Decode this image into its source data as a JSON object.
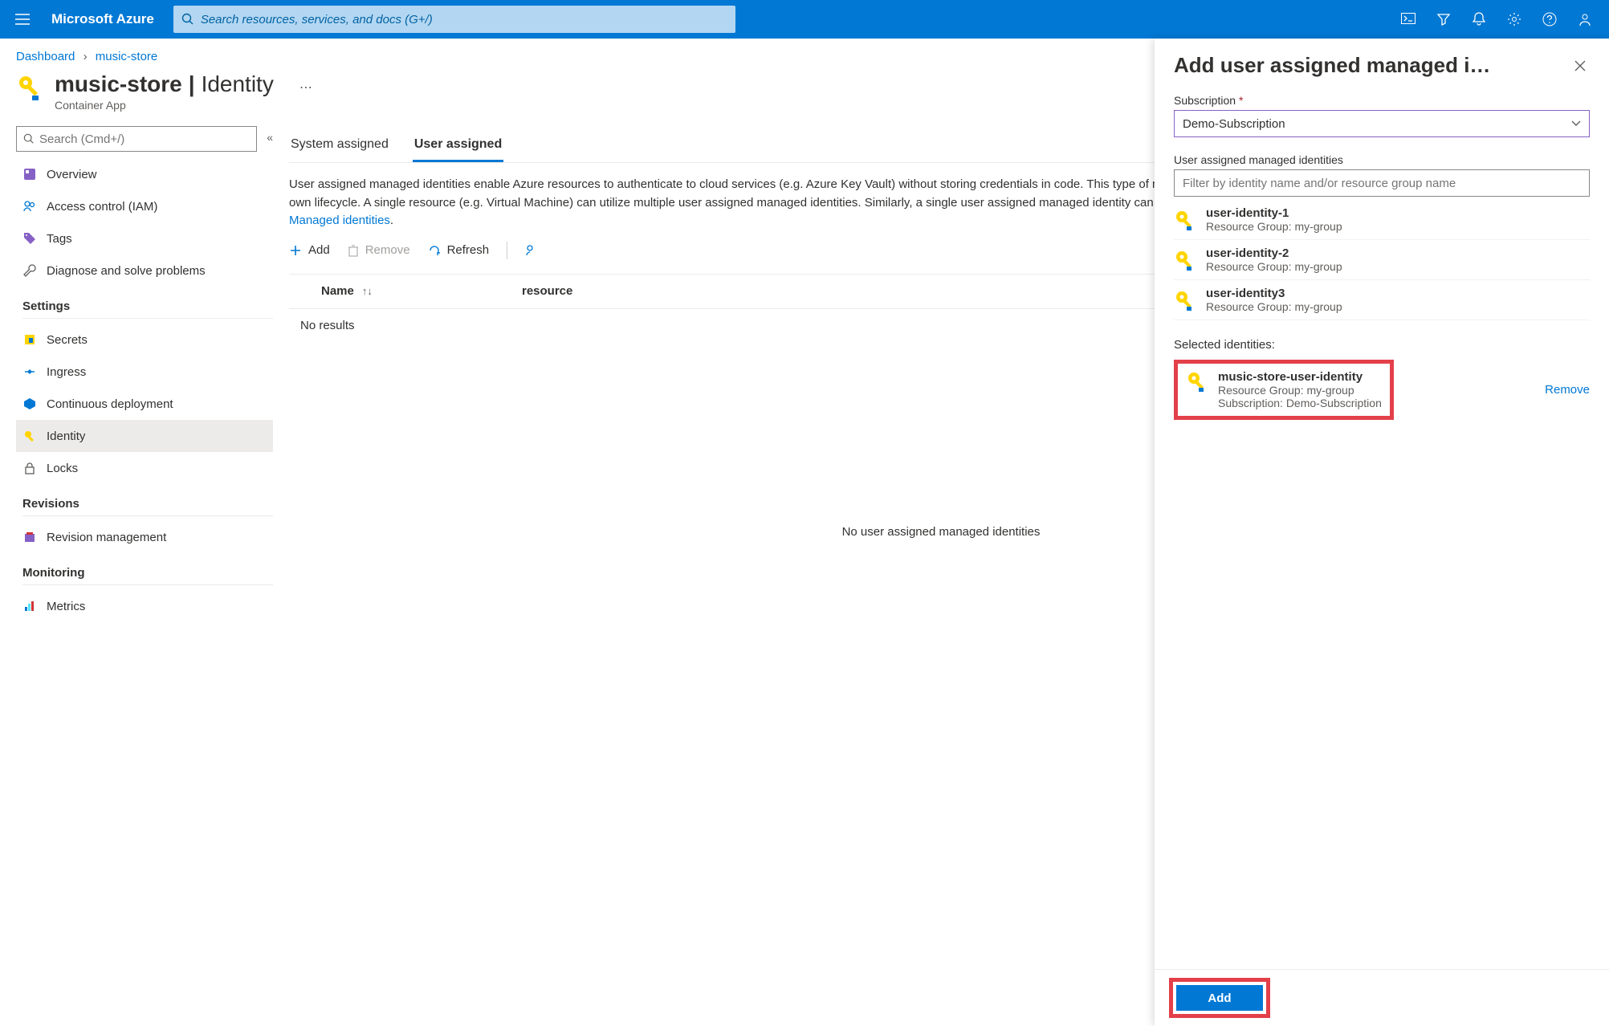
{
  "header": {
    "brand": "Microsoft Azure",
    "search_placeholder": "Search resources, services, and docs (G+/)"
  },
  "breadcrumb": {
    "items": [
      "Dashboard",
      "music-store"
    ]
  },
  "resource": {
    "name": "music-store",
    "section": "Identity",
    "type": "Container App"
  },
  "sidebar": {
    "search_placeholder": "Search (Cmd+/)",
    "top_items": [
      {
        "label": "Overview"
      },
      {
        "label": "Access control (IAM)"
      },
      {
        "label": "Tags"
      },
      {
        "label": "Diagnose and solve problems"
      }
    ],
    "sections": [
      {
        "title": "Settings",
        "items": [
          {
            "label": "Secrets"
          },
          {
            "label": "Ingress"
          },
          {
            "label": "Continuous deployment"
          },
          {
            "label": "Identity",
            "active": true
          },
          {
            "label": "Locks"
          }
        ]
      },
      {
        "title": "Revisions",
        "items": [
          {
            "label": "Revision management"
          }
        ]
      },
      {
        "title": "Monitoring",
        "items": [
          {
            "label": "Metrics"
          }
        ]
      }
    ]
  },
  "tabs": [
    {
      "label": "System assigned",
      "active": false
    },
    {
      "label": "User assigned",
      "active": true
    }
  ],
  "description": {
    "text": "User assigned managed identities enable Azure resources to authenticate to cloud services (e.g. Azure Key Vault) without storing credentials in code. This type of managed identities are created as standalone Azure resources, and have their own lifecycle. A single resource (e.g. Virtual Machine) can utilize multiple user assigned managed identities. Similarly, a single user assigned managed identity can be shared across multiple resources (e.g. Virtual Machines). Learn more about",
    "link": "Managed identities"
  },
  "toolbar": {
    "add": "Add",
    "remove": "Remove",
    "refresh": "Refresh"
  },
  "table": {
    "col_name": "Name",
    "col_rest": "resource",
    "no_results": "No results",
    "empty": "No user assigned managed identities"
  },
  "flyout": {
    "title": "Add user assigned managed i…",
    "sub_label": "Subscription",
    "sub_value": "Demo-Subscription",
    "list_label": "User assigned managed identities",
    "filter_placeholder": "Filter by identity name and/or resource group name",
    "items": [
      {
        "name": "user-identity-1",
        "rg": "Resource Group: my-group"
      },
      {
        "name": "user-identity-2",
        "rg": "Resource Group: my-group"
      },
      {
        "name": "user-identity3",
        "rg": "Resource Group: my-group"
      }
    ],
    "selected_label": "Selected identities:",
    "selected": {
      "name": "music-store-user-identity",
      "rg": "Resource Group: my-group",
      "sub": "Subscription: Demo-Subscription"
    },
    "remove": "Remove",
    "add_button": "Add"
  }
}
